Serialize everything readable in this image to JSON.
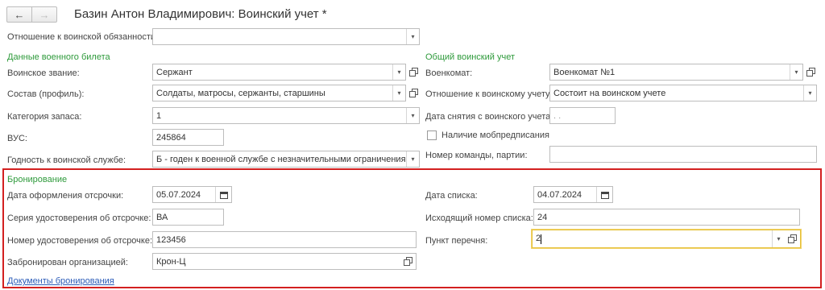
{
  "window": {
    "title": "Базин Антон Владимирович: Воинский учет *"
  },
  "relation": {
    "label": "Отношение к воинской обязанности:",
    "value": ""
  },
  "military_id": {
    "group_title": "Данные военного билета",
    "rank_label": "Воинское звание:",
    "rank_value": "Сержант",
    "composition_label": "Состав (профиль):",
    "composition_value": "Солдаты, матросы, сержанты, старшины",
    "reserve_label": "Категория запаса:",
    "reserve_value": "1",
    "vus_label": "ВУС:",
    "vus_value": "245864",
    "fitness_label": "Годность к воинской службе:",
    "fitness_value": "Б - годен к военной службе с незначительными ограничениями"
  },
  "general": {
    "group_title": "Общий воинский учет",
    "commissariat_label": "Военкомат:",
    "commissariat_value": "Военкомат №1",
    "registry_label": "Отношение к воинскому учету:",
    "registry_value": "Состоит на воинском учете",
    "removal_date_label": "Дата снятия с воинского учета:",
    "removal_date_value": ". .",
    "mob_label": "Наличие мобпредписания",
    "team_label": "Номер команды, партии:",
    "team_value": ""
  },
  "reservation": {
    "group_title": "Бронирование",
    "deferral_date_label": "Дата оформления отсрочки:",
    "deferral_date_value": "05.07.2024",
    "cert_series_label": "Серия удостоверения об отсрочке:",
    "cert_series_value": "ВА",
    "cert_number_label": "Номер удостоверения об отсрочке:",
    "cert_number_value": "123456",
    "org_label": "Забронирован организацией:",
    "org_value": "Крон-Ц",
    "list_date_label": "Дата списка:",
    "list_date_value": "04.07.2024",
    "list_number_label": "Исходящий номер списка:",
    "list_number_value": "24",
    "item_label": "Пункт перечня:",
    "item_value": "2",
    "docs_link": "Документы бронирования"
  },
  "colors": {
    "group_title": "#2e9a3b",
    "highlight_border": "#d32020",
    "focus_border": "#e5c13a",
    "link": "#2a5bb8"
  },
  "icons": [
    "back-arrow-icon",
    "forward-arrow-icon",
    "dropdown-arrow-icon",
    "open-icon",
    "calendar-icon"
  ]
}
